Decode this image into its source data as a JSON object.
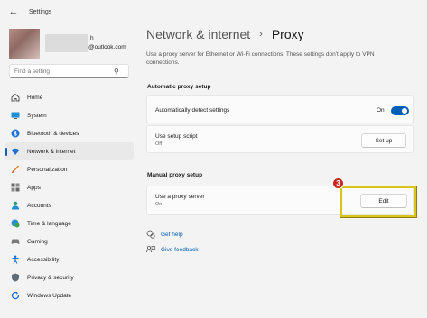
{
  "app": {
    "title": "Settings"
  },
  "profile": {
    "name": "h",
    "email": "@outlook.com"
  },
  "search": {
    "placeholder": "Find a setting"
  },
  "sidebar": {
    "items": [
      {
        "label": "Home",
        "icon": "home-icon"
      },
      {
        "label": "System",
        "icon": "monitor-icon"
      },
      {
        "label": "Bluetooth & devices",
        "icon": "bluetooth-icon"
      },
      {
        "label": "Network & internet",
        "icon": "wifi-icon",
        "active": true
      },
      {
        "label": "Personalization",
        "icon": "brush-icon"
      },
      {
        "label": "Apps",
        "icon": "apps-icon"
      },
      {
        "label": "Accounts",
        "icon": "person-icon"
      },
      {
        "label": "Time & language",
        "icon": "globe-clock-icon"
      },
      {
        "label": "Gaming",
        "icon": "controller-icon"
      },
      {
        "label": "Accessibility",
        "icon": "accessibility-icon"
      },
      {
        "label": "Privacy & security",
        "icon": "shield-icon"
      },
      {
        "label": "Windows Update",
        "icon": "update-icon"
      }
    ]
  },
  "main": {
    "breadcrumb_parent": "Network & internet",
    "breadcrumb_current": "Proxy",
    "description": "Use a proxy server for Ethernet or Wi-Fi connections. These settings don't apply to VPN connections.",
    "auto_section_title": "Automatic proxy setup",
    "auto_detect_label": "Automatically detect settings",
    "auto_detect_state": "On",
    "setup_script_label": "Use setup script",
    "setup_script_state": "Off",
    "setup_button": "Set up",
    "manual_section_title": "Manual proxy setup",
    "proxy_server_label": "Use a proxy server",
    "proxy_server_state": "On",
    "edit_button": "Edit",
    "step_number": "3",
    "help_link": "Get help",
    "feedback_link": "Give feedback"
  },
  "colors": {
    "accent": "#005fb8",
    "highlight": "#d7c51a",
    "badge": "#c8281f"
  }
}
